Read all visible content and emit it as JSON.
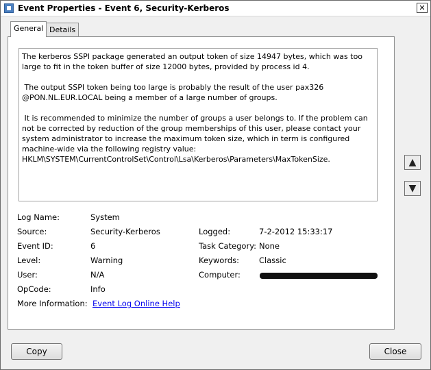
{
  "window": {
    "title": "Event Properties - Event 6, Security-Kerberos",
    "close_glyph": "✕"
  },
  "tabs": [
    {
      "label": "General",
      "active": true
    },
    {
      "label": "Details",
      "active": false
    }
  ],
  "description": "The kerberos SSPI package generated an output token of size 14947 bytes, which was too large to fit in the token buffer of size 12000 bytes, provided by process id 4.\n\n The output SSPI token being too large is probably the result of the user pax326 @PON.NL.EUR.LOCAL being a member of a large number of groups.\n\n It is recommended to minimize the number of groups a user belongs to. If the problem can not be corrected by reduction of the group memberships of this user, please contact your system administrator to increase the maximum token size, which in term is configured machine-wide via the following registry value: HKLM\\SYSTEM\\CurrentControlSet\\Control\\Lsa\\Kerberos\\Parameters\\MaxTokenSize.",
  "fields": {
    "log_name": {
      "label": "Log Name:",
      "value": "System"
    },
    "source": {
      "label": "Source:",
      "value": "Security-Kerberos"
    },
    "event_id": {
      "label": "Event ID:",
      "value": "6"
    },
    "level": {
      "label": "Level:",
      "value": "Warning"
    },
    "user": {
      "label": "User:",
      "value": "N/A"
    },
    "opcode": {
      "label": "OpCode:",
      "value": "Info"
    },
    "more_info": {
      "label": "More Information:",
      "value": "Event Log Online Help"
    },
    "logged": {
      "label": "Logged:",
      "value": "7-2-2012 15:33:17"
    },
    "task_category": {
      "label": "Task Category:",
      "value": "None"
    },
    "keywords": {
      "label": "Keywords:",
      "value": "Classic"
    },
    "computer": {
      "label": "Computer:"
    }
  },
  "nav": {
    "up_glyph": "▲",
    "down_glyph": "▼"
  },
  "buttons": {
    "copy": "Copy",
    "close": "Close"
  }
}
